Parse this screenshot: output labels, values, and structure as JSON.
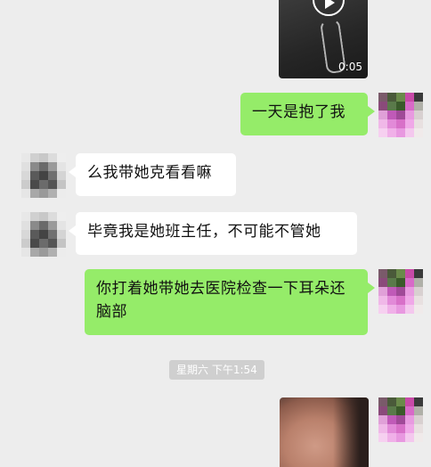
{
  "messages": [
    {
      "id": "video",
      "type": "video",
      "direction": "sent",
      "duration": "0:05"
    },
    {
      "id": "m1",
      "type": "text",
      "direction": "sent",
      "text": "一天是抱了我"
    },
    {
      "id": "m2",
      "type": "text",
      "direction": "received",
      "text": "么我带她克看看嘛"
    },
    {
      "id": "m3",
      "type": "text",
      "direction": "received",
      "text": "毕竟我是她班主任，不可能不管她"
    },
    {
      "id": "m4",
      "type": "text",
      "direction": "sent",
      "text": "你打着她带她去医院检查一下耳朵还脑部"
    },
    {
      "id": "ts",
      "type": "timestamp",
      "text": "星期六 下午1:54"
    },
    {
      "id": "photo",
      "type": "image",
      "direction": "sent"
    }
  ],
  "colors": {
    "background": "#ededed",
    "sent_bubble": "#95ec69",
    "received_bubble": "#ffffff"
  }
}
